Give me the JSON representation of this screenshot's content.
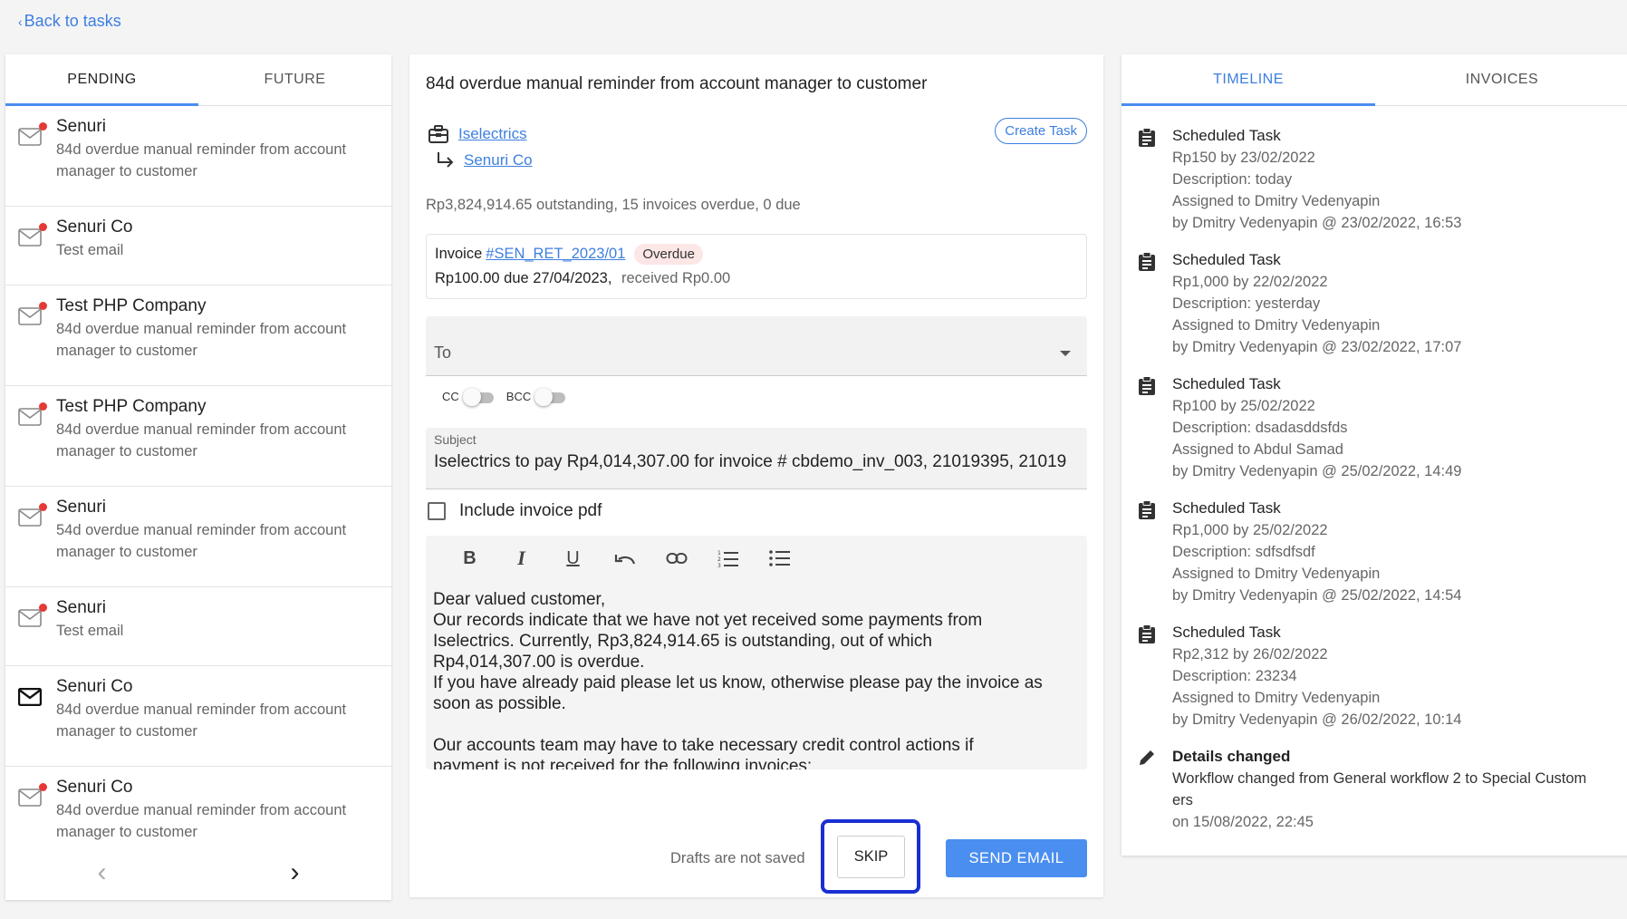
{
  "nav": {
    "back_label": "Back to tasks"
  },
  "left": {
    "tabs": [
      "PENDING",
      "FUTURE"
    ],
    "tasks": [
      {
        "title": "Senuri",
        "sub1": "84d overdue manual reminder from account",
        "sub2": "manager to customer",
        "unread": true
      },
      {
        "title": "Senuri Co",
        "sub1": "Test email",
        "sub2": "",
        "unread": true
      },
      {
        "title": "Test PHP Company",
        "sub1": "84d overdue manual reminder from account",
        "sub2": "manager to customer",
        "unread": true
      },
      {
        "title": "Test PHP Company",
        "sub1": "84d overdue manual reminder from account",
        "sub2": "manager to customer",
        "unread": true
      },
      {
        "title": "Senuri",
        "sub1": "54d overdue manual reminder from account",
        "sub2": "manager to customer",
        "unread": true
      },
      {
        "title": "Senuri",
        "sub1": "Test email",
        "sub2": "",
        "unread": true
      },
      {
        "title": "Senuri Co",
        "sub1": "84d overdue manual reminder from account",
        "sub2": "manager to customer",
        "unread": false
      },
      {
        "title": "Senuri Co",
        "sub1": "84d overdue manual reminder from account",
        "sub2": "manager to customer",
        "unread": true
      }
    ],
    "prev": "‹",
    "next": "›"
  },
  "mid": {
    "title": "84d overdue manual reminder from account manager to customer",
    "company": "Iselectrics",
    "contact": "Senuri Co",
    "create_task": "Create Task",
    "summary": "Rp3,824,914.65 outstanding, 15 invoices overdue, 0 due",
    "invoice": {
      "label": "Invoice",
      "number": "#SEN_RET_2023/01",
      "status": "Overdue",
      "amount": "Rp100.00 due 27/04/2023,",
      "received": "received Rp0.00"
    },
    "to_label": "To",
    "cc_label": "CC",
    "bcc_label": "BCC",
    "subject_label": "Subject",
    "subject_value": "Iselectrics to pay Rp4,014,307.00 for invoice # cbdemo_inv_003, 21019395, 21019",
    "include_pdf": "Include invoice pdf",
    "body": {
      "l1": "Dear valued customer,",
      "l2": "Our records indicate that we have not yet received some payments from",
      "l3": "Iselectrics. Currently, Rp3,824,914.65 is outstanding, out of which",
      "l4": "Rp4,014,307.00 is overdue.",
      "l5": "If you have already paid please let us know, otherwise please pay the invoice as",
      "l6": "soon as possible.",
      "l7": "Our accounts team may have to take necessary credit control actions if",
      "l8": "payment is not received for the following invoices:"
    },
    "toolbar": {
      "bold": "B",
      "italic": "I",
      "underline": "U"
    },
    "drafts_note": "Drafts are not saved",
    "skip": "SKIP",
    "send": "SEND EMAIL"
  },
  "right": {
    "tabs": [
      "TIMELINE",
      "INVOICES"
    ],
    "events": [
      {
        "title": "Scheduled Task",
        "l1": "Rp150 by 23/02/2022",
        "l2": "Description: today",
        "l3": "Assigned to Dmitry Vedenyapin",
        "l4": "by Dmitry Vedenyapin @ 23/02/2022, 16:53"
      },
      {
        "title": "Scheduled Task",
        "l1": "Rp1,000 by 22/02/2022",
        "l2": "Description: yesterday",
        "l3": "Assigned to Dmitry Vedenyapin",
        "l4": "by Dmitry Vedenyapin @ 23/02/2022, 17:07"
      },
      {
        "title": "Scheduled Task",
        "l1": "Rp100 by 25/02/2022",
        "l2": "Description: dsadasddsfds",
        "l3": "Assigned to Abdul Samad",
        "l4": "by Dmitry Vedenyapin @ 25/02/2022, 14:49"
      },
      {
        "title": "Scheduled Task",
        "l1": "Rp1,000 by 25/02/2022",
        "l2": "Description: sdfsdfsdf",
        "l3": "Assigned to Dmitry Vedenyapin",
        "l4": "by Dmitry Vedenyapin @ 25/02/2022, 14:54"
      },
      {
        "title": "Scheduled Task",
        "l1": "Rp2,312 by 26/02/2022",
        "l2": "Description: 23234",
        "l3": "Assigned to Dmitry Vedenyapin",
        "l4": "by Dmitry Vedenyapin @ 26/02/2022, 10:14"
      }
    ],
    "details": {
      "title": "Details changed",
      "l1": "Workflow changed from General workflow 2 to Special Custom",
      "l2": "ers",
      "l3": "on 15/08/2022, 22:45"
    }
  },
  "colors": {
    "accent": "#4a8ef0",
    "link": "#3d7fe0",
    "unread_dot": "#e53935",
    "highlight": "#1a2fd1"
  }
}
